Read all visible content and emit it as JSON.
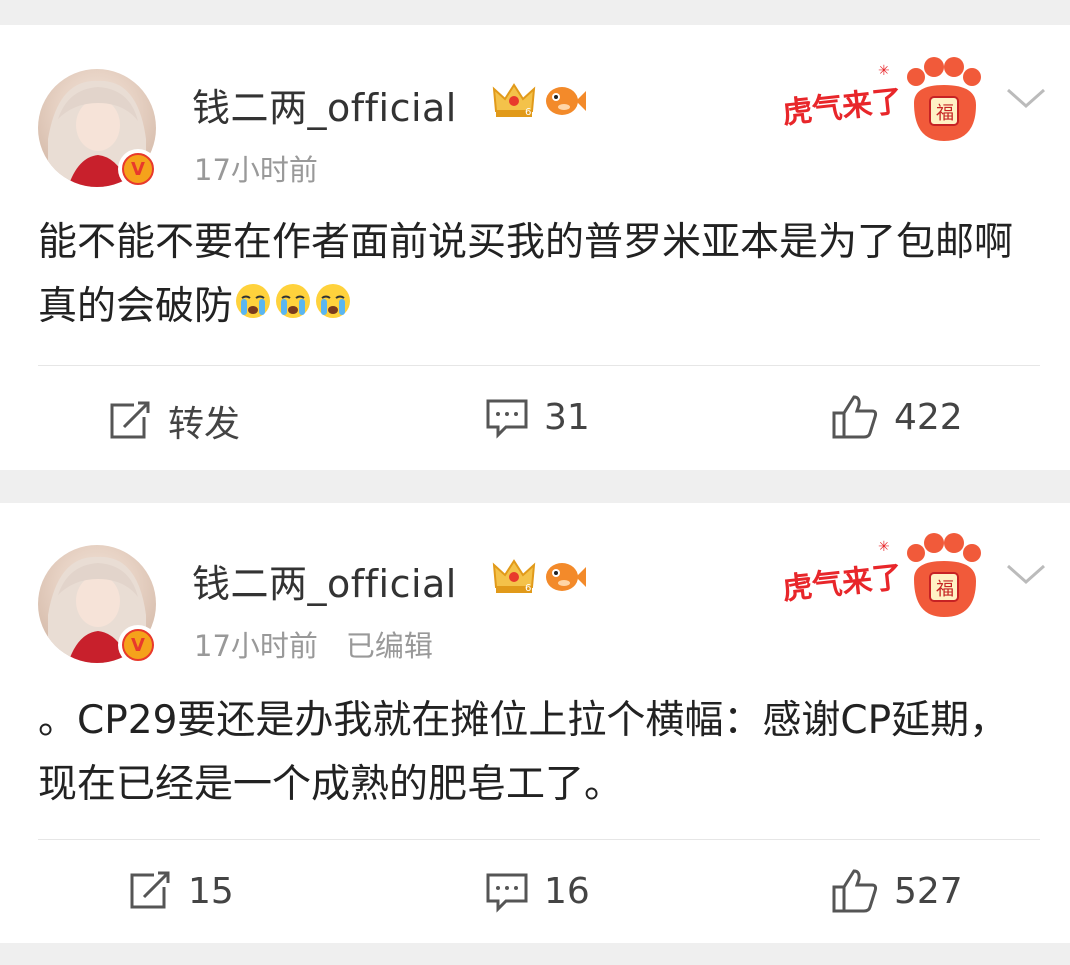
{
  "posts": [
    {
      "username": "钱二两_official",
      "time": "17小时前",
      "edited": "",
      "content": "能不能不要在作者面前说买我的普罗米亚本是为了包邮啊真的会破防",
      "emoji": [
        "crying-face",
        "crying-face",
        "crying-face"
      ],
      "actions": {
        "repost": "转发",
        "comments": "31",
        "likes": "422"
      }
    },
    {
      "username": "钱二两_official",
      "time": "17小时前",
      "edited": "已编辑",
      "content": "。CP29要还是办我就在摊位上拉个横幅：感谢CP延期，现在已经是一个成熟的肥皂工了。",
      "emoji": [],
      "actions": {
        "repost": "15",
        "comments": "16",
        "likes": "527"
      }
    }
  ],
  "promo_text": "虎气来了",
  "verified_mark": "V",
  "colors": {
    "promo_red": "#e8262a",
    "verified_orange": "#f5a21b",
    "text_gray": "#999999"
  }
}
